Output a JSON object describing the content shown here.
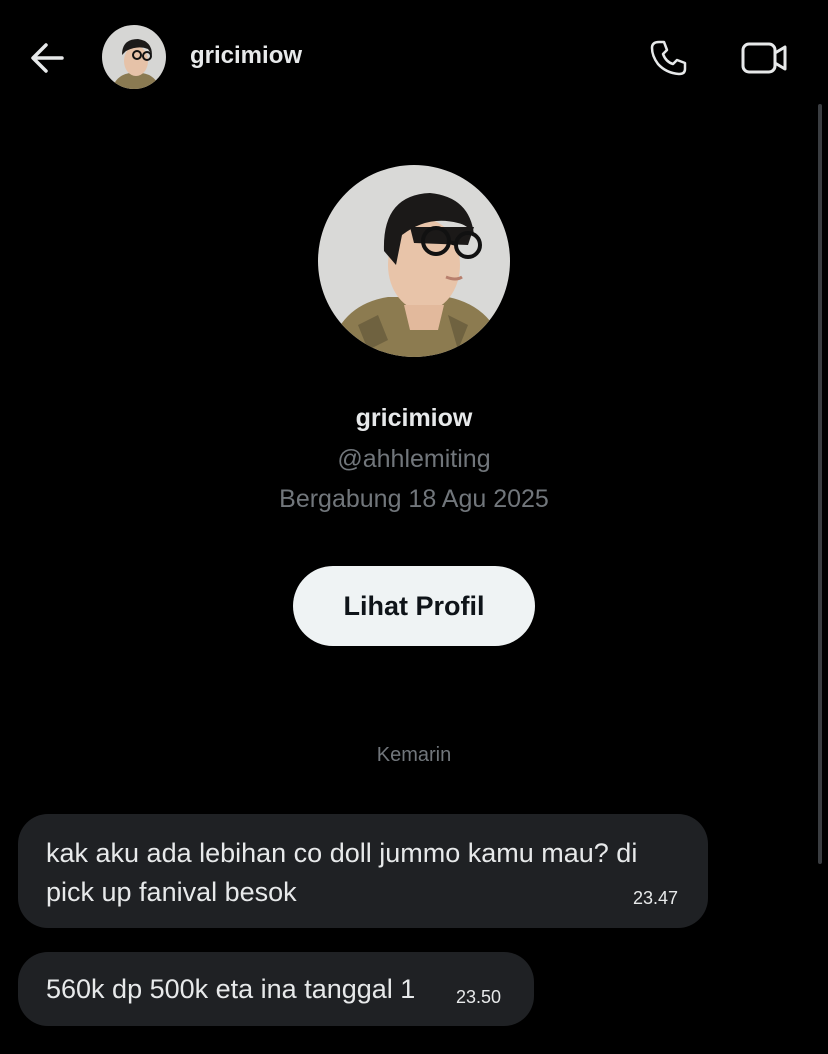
{
  "header": {
    "username": "gricimiow",
    "icons": {
      "back": "arrow-left-icon",
      "call": "phone-icon",
      "video": "video-camera-icon"
    }
  },
  "profile": {
    "display_name": "gricimiow",
    "handle": "@ahhlemiting",
    "joined": "Bergabung 18 Agu 2025",
    "view_profile_label": "Lihat Profil"
  },
  "conversation": {
    "date_separator": "Kemarin",
    "messages": [
      {
        "text": "kak aku ada lebihan co doll jummo kamu mau? di pick up fanival besok",
        "time": "23.47"
      },
      {
        "text": "560k dp 500k eta ina tanggal 1",
        "time": "23.50"
      }
    ]
  },
  "colors": {
    "background": "#000000",
    "bubble": "#1f2124",
    "primary_text": "#e7e9ea",
    "secondary_text": "#71767b",
    "button_bg": "#eff3f4"
  }
}
